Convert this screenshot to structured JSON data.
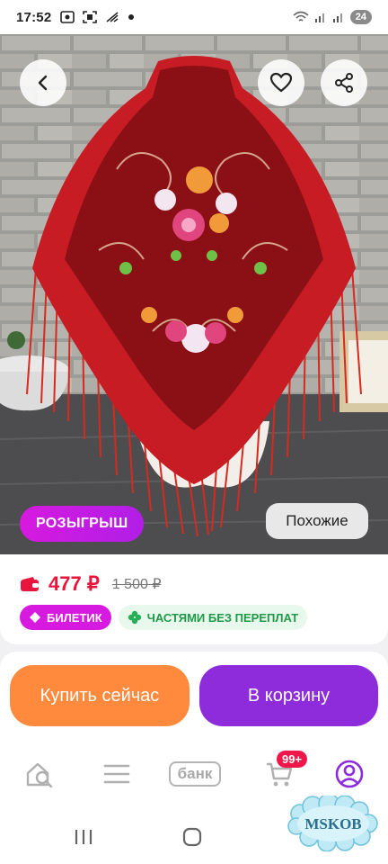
{
  "status_bar": {
    "time": "17:52",
    "battery": "24",
    "icons": [
      "photo-icon",
      "scan-icon",
      "no-signal-icon",
      "dot-icon",
      "wifi-icon",
      "signal-icon",
      "signal-icon"
    ]
  },
  "product": {
    "photo_description_icon": "shawl-photo",
    "actions": {
      "back_icon": "chevron-left-icon",
      "favorite_icon": "heart-icon",
      "share_icon": "share-icon"
    },
    "raffle_label": "РОЗЫГРЫШ",
    "similar_label": "Похожие"
  },
  "price": {
    "current": "477 ₽",
    "old": "1 500 ₽",
    "badges": {
      "ticket": "БИЛЕТИК",
      "installment": "ЧАСТЯМИ БЕЗ ПЕРЕПЛАТ"
    }
  },
  "buttons": {
    "buy_now": "Купить сейчас",
    "add_to_cart": "В корзину"
  },
  "bottom_nav": {
    "home_icon": "home-search-icon",
    "catalog_icon": "menu-icon",
    "bank_label": "банк",
    "cart_count": "99+",
    "profile_icon": "profile-icon"
  },
  "watermark": "MSKOB",
  "colors": {
    "accent_magenta": "#d61adf",
    "price_red": "#e8163c",
    "buy_orange": "#ff8a3d",
    "cart_purple": "#8e2bdb",
    "installment_green": "#1f9a48"
  }
}
